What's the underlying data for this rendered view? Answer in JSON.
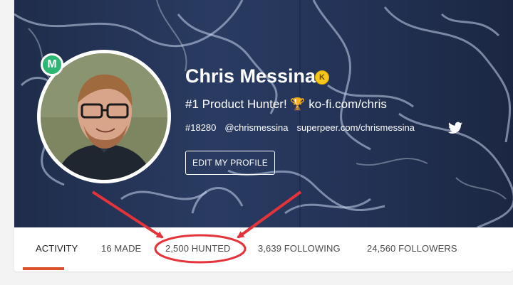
{
  "profile": {
    "name": "Chris Messina",
    "level_badge": "K",
    "maker_badge": "M",
    "headline": "#1 Product Hunter! 🏆 ko-fi.com/chris",
    "rank": "#18280",
    "handle": "@chrismessina",
    "website": "superpeer.com/chrismessina",
    "edit_button": "EDIT MY PROFILE"
  },
  "tabs": [
    {
      "label": "ACTIVITY",
      "active": true
    },
    {
      "label": "16 MADE",
      "active": false
    },
    {
      "label": "2,500 HUNTED",
      "active": false
    },
    {
      "label": "3,639 FOLLOWING",
      "active": false
    },
    {
      "label": "24,560 FOLLOWERS",
      "active": false
    }
  ],
  "icons": {
    "social": "twitter-icon"
  },
  "colors": {
    "maker_badge": "#2bb673",
    "level_badge": "#f5c71a",
    "active_tab_underline": "#d9502d",
    "annotation": "#e5333b"
  }
}
